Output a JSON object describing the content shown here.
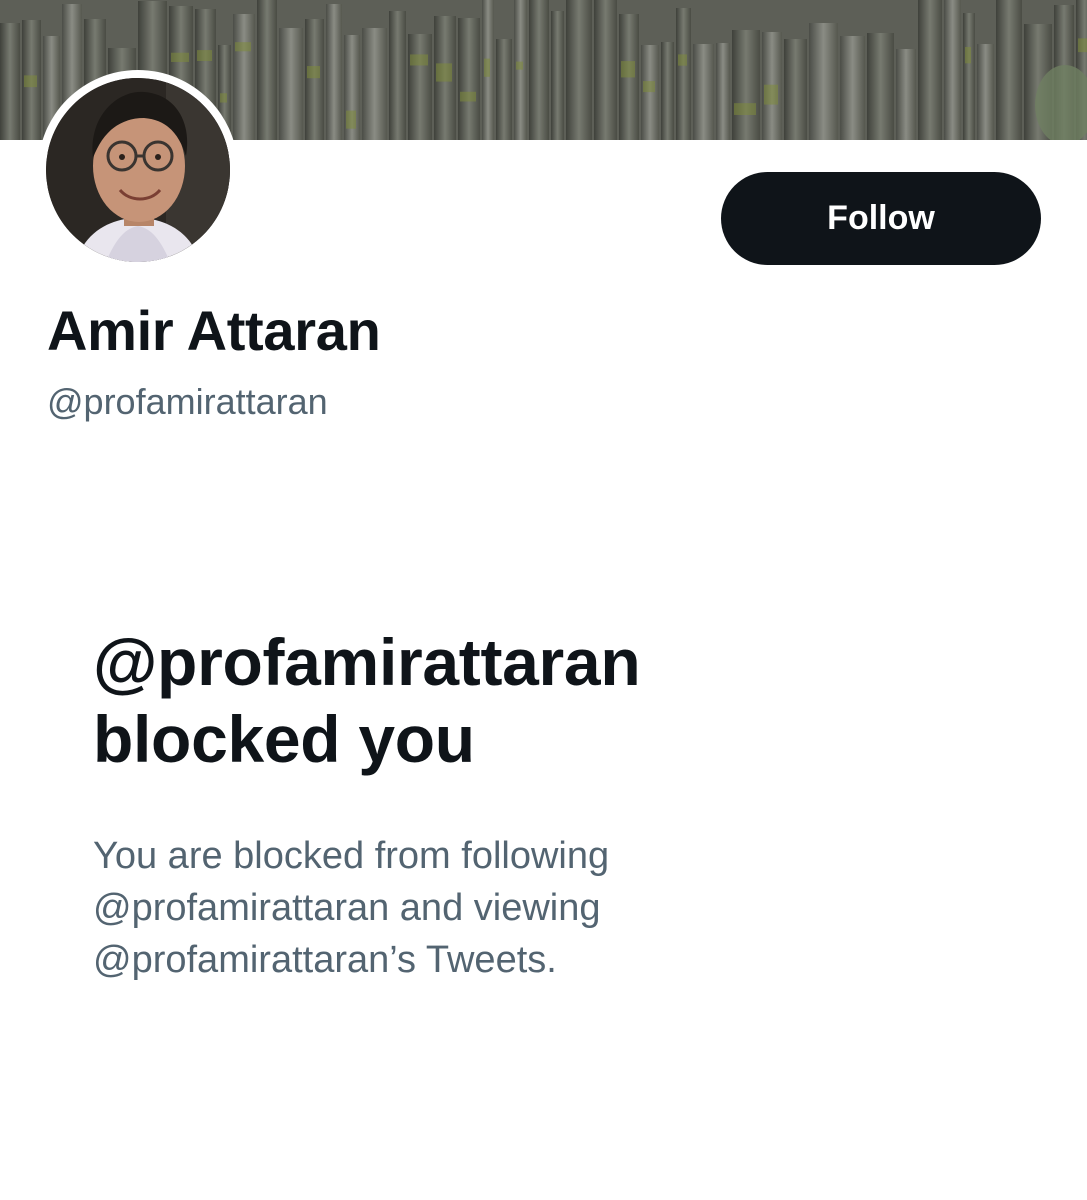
{
  "profile": {
    "display_name": "Amir Attaran",
    "handle": "@profamirattaran",
    "banner_image": "basalt-columns-photo",
    "avatar_image": "profile-photo"
  },
  "actions": {
    "follow_label": "Follow"
  },
  "blocked_notice": {
    "title_line1": "@profamirattaran",
    "title_line2": "blocked you",
    "description_line1": "You are blocked from following",
    "description_line2": "@profamirattaran and viewing",
    "description_line3": "@profamirattaran’s Tweets."
  },
  "colors": {
    "primary_text": "#0f1419",
    "secondary_text": "#536471",
    "button_bg": "#0f1419",
    "button_text": "#ffffff",
    "background": "#ffffff"
  }
}
